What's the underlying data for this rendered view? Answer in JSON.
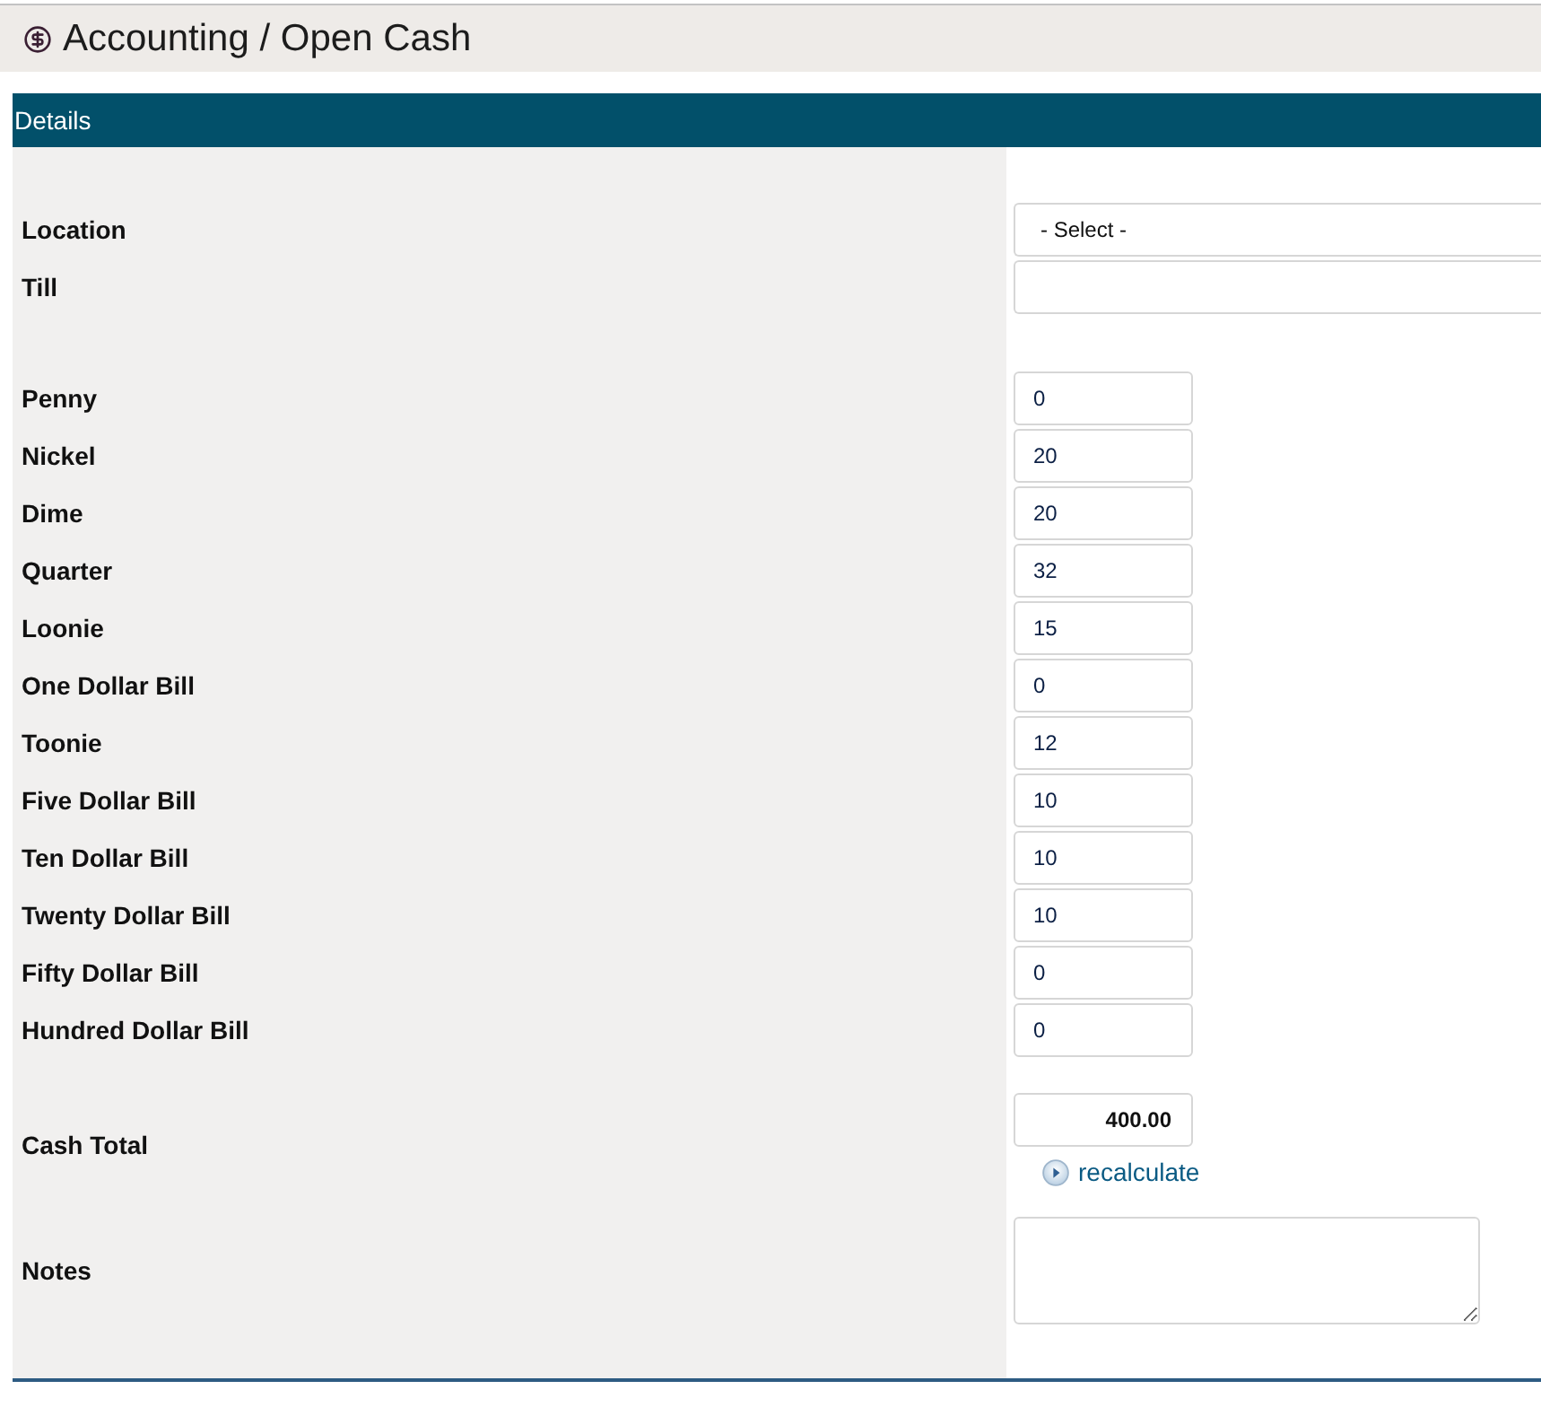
{
  "header": {
    "title": "Accounting / Open Cash"
  },
  "section": {
    "title": "Details"
  },
  "fields": [
    {
      "label": "Location",
      "kind": "select",
      "value": "- Select -"
    },
    {
      "label": "Till",
      "kind": "text"
    }
  ],
  "denominations": [
    {
      "label": "Penny",
      "value": "0"
    },
    {
      "label": "Nickel",
      "value": "20"
    },
    {
      "label": "Dime",
      "value": "20"
    },
    {
      "label": "Quarter",
      "value": "32"
    },
    {
      "label": "Loonie",
      "value": "15"
    },
    {
      "label": "One Dollar Bill",
      "value": "0"
    },
    {
      "label": "Toonie",
      "value": "12"
    },
    {
      "label": "Five Dollar Bill",
      "value": "10"
    },
    {
      "label": "Ten Dollar Bill",
      "value": "10"
    },
    {
      "label": "Twenty Dollar Bill",
      "value": "10"
    },
    {
      "label": "Fifty Dollar Bill",
      "value": "0"
    },
    {
      "label": "Hundred Dollar Bill",
      "value": "0"
    }
  ],
  "cash_total": {
    "label": "Cash Total",
    "value": "400.00",
    "action": "recalculate"
  },
  "notes": {
    "label": "Notes"
  }
}
